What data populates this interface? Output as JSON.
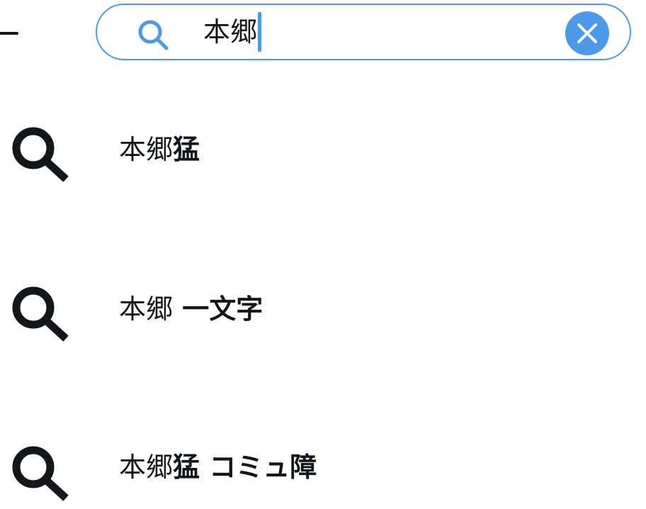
{
  "header": {
    "back_icon": "arrow-left-icon",
    "search": {
      "icon": "search-icon",
      "value": "本郷",
      "clear_icon": "close-icon",
      "accent_color": "#4a9ae8"
    }
  },
  "suggestions": [
    {
      "icon": "search-icon",
      "match": "本郷",
      "rest": "猛"
    },
    {
      "icon": "search-icon",
      "match": "本郷",
      "rest": " 一文字"
    },
    {
      "icon": "search-icon",
      "match": "本郷",
      "rest": "猛 コミュ障"
    }
  ],
  "colors": {
    "accent": "#4a9ae8",
    "text": "#14171a",
    "background": "#ffffff"
  }
}
